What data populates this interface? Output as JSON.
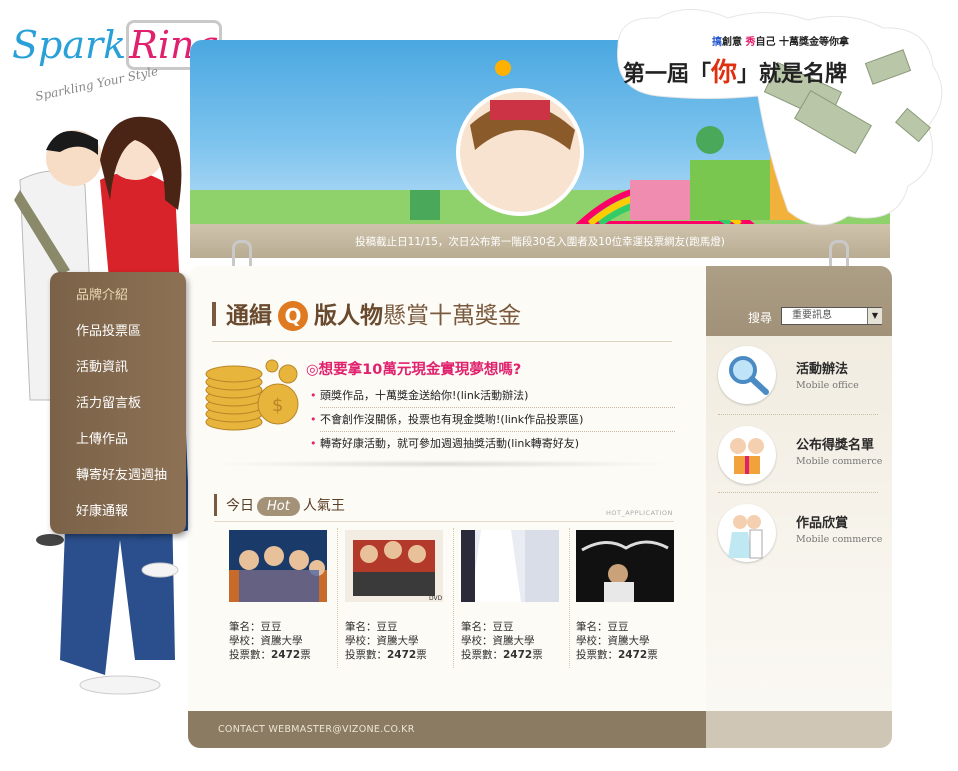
{
  "logo": {
    "brand_part1": "Spark",
    "brand_part2": "Ring",
    "tagline": "Sparkling Your Style"
  },
  "banner": {
    "slogan_top_1": "搞",
    "slogan_top_2": "創意 ",
    "slogan_top_3": "秀",
    "slogan_top_4": "自己 十萬獎金等你拿",
    "slogan_main_1": "第一屆「",
    "slogan_main_2": "你",
    "slogan_main_3": "」就是名牌",
    "notice": "投稿截止日11/15，次日公布第一階段30名入圍者及10位幸運投票網友(跑馬燈)"
  },
  "menu": {
    "items": [
      {
        "label": "品牌介紹"
      },
      {
        "label": "作品投票區"
      },
      {
        "label": "活動資訊"
      },
      {
        "label": "活力留言板"
      },
      {
        "label": "上傳作品"
      },
      {
        "label": "轉寄好友週週抽"
      },
      {
        "label": "好康通報"
      }
    ]
  },
  "main": {
    "title_1": "通緝",
    "title_q": "Q",
    "title_2": "版人物",
    "title_3": "懸賞十萬獎金",
    "promo_head": "◎想要拿10萬元現金實現夢想嗎?",
    "promo_items": [
      "頭獎作品，十萬獎金送給你!(link活動辦法)",
      "不會創作沒關係，投票也有現金獎喲!(link作品投票區)",
      "轉寄好康活動，就可參加週週抽獎活動(link轉寄好友)"
    ]
  },
  "hot": {
    "title_1": "今日",
    "title_pill": "Hot",
    "title_2": "人氣王",
    "tag": "HOT_APPLICATION",
    "cards": [
      {
        "pen_label": "筆名：",
        "pen": "豆豆",
        "school_label": "學校：",
        "school": "資騰大學",
        "votes_label": "投票數：",
        "votes": "2472",
        "unit": "票"
      },
      {
        "pen_label": "筆名：",
        "pen": "豆豆",
        "school_label": "學校：",
        "school": "資騰大學",
        "votes_label": "投票數：",
        "votes": "2472",
        "unit": "票"
      },
      {
        "pen_label": "筆名：",
        "pen": "豆豆",
        "school_label": "學校：",
        "school": "資騰大學",
        "votes_label": "投票數：",
        "votes": "2472",
        "unit": "票"
      },
      {
        "pen_label": "筆名：",
        "pen": "豆豆",
        "school_label": "學校：",
        "school": "資騰大學",
        "votes_label": "投票數：",
        "votes": "2472",
        "unit": "票"
      }
    ]
  },
  "side": {
    "search_label": "搜尋",
    "search_value": "重要訊息",
    "items": [
      {
        "title": "活動辦法",
        "sub": "Mobile office",
        "icon": "magnifier-icon"
      },
      {
        "title": "公布得獎名單",
        "sub": "Mobile commerce",
        "icon": "gift-couple-icon"
      },
      {
        "title": "作品欣賞",
        "sub": "Mobile commerce",
        "icon": "wedding-couple-icon"
      }
    ]
  },
  "footer": {
    "contact": "CONTACT WEBMASTER@VIZONE.CO.KR"
  },
  "colors": {
    "accent": "#e0226e",
    "brown": "#8a7b62",
    "menu": "#7a6248",
    "sky": "#4aa7e0"
  }
}
